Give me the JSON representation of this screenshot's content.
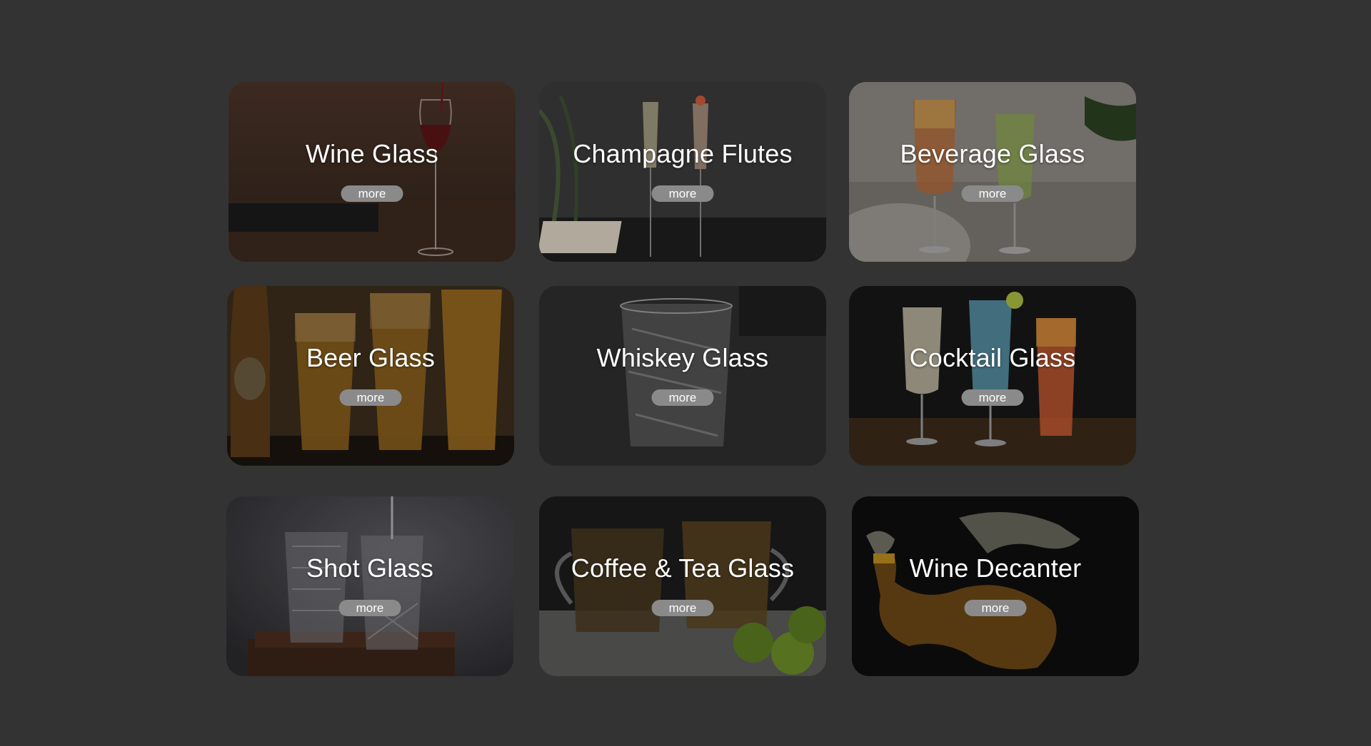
{
  "categories": [
    {
      "title": "Wine Glass",
      "more_label": "more"
    },
    {
      "title": "Champagne Flutes",
      "more_label": "more"
    },
    {
      "title": "Beverage Glass",
      "more_label": "more"
    },
    {
      "title": "Beer Glass",
      "more_label": "more"
    },
    {
      "title": "Whiskey Glass",
      "more_label": "more"
    },
    {
      "title": "Cocktail Glass",
      "more_label": "more"
    },
    {
      "title": "Shot Glass",
      "more_label": "more"
    },
    {
      "title": "Coffee & Tea Glass",
      "more_label": "more"
    },
    {
      "title": "Wine Decanter",
      "more_label": "more"
    }
  ],
  "colors": {
    "page_background": "#333333",
    "button_background": "#8a8a8a",
    "title_text": "#ffffff"
  }
}
